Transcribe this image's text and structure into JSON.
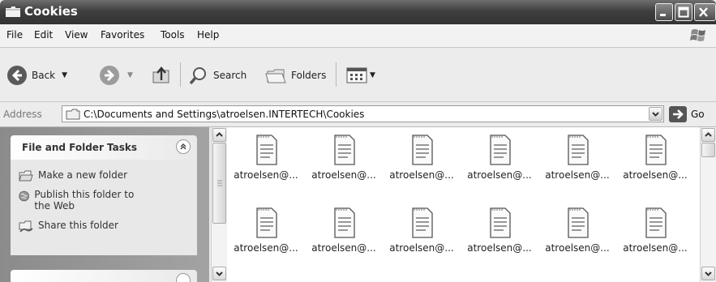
{
  "window": {
    "title": "Cookies"
  },
  "menu": [
    "File",
    "Edit",
    "View",
    "Favorites",
    "Tools",
    "Help"
  ],
  "toolbar": {
    "back": "Back",
    "search": "Search",
    "folders": "Folders"
  },
  "address": {
    "label": "Address",
    "path": "C:\\Documents and Settings\\atroelsen.INTERTECH\\Cookies",
    "go": "Go"
  },
  "tasks": {
    "title": "File and Folder Tasks",
    "items": [
      "Make a new folder",
      "Publish this folder to the Web",
      "Share this folder"
    ]
  },
  "files": [
    "atroelsen@...",
    "atroelsen@...",
    "atroelsen@...",
    "atroelsen@...",
    "atroelsen@...",
    "atroelsen@...",
    "atroelsen@...",
    "atroelsen@...",
    "atroelsen@...",
    "atroelsen@...",
    "atroelsen@...",
    "atroelsen@..."
  ],
  "icons": {
    "title": "folder-icon",
    "back": "back-arrow-icon",
    "forward": "forward-arrow-icon",
    "up": "folder-up-icon",
    "search": "search-icon",
    "folders": "folders-icon",
    "views": "views-icon",
    "file": "text-file-icon"
  }
}
